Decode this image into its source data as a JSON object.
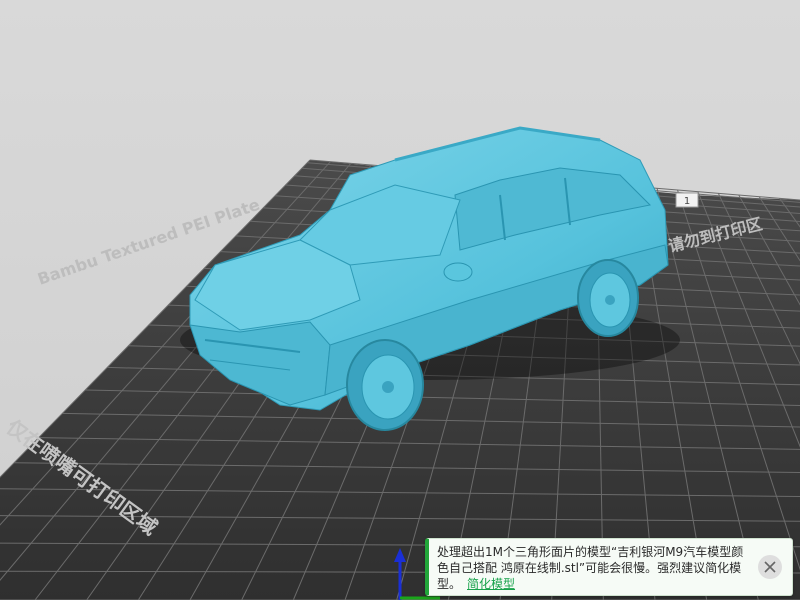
{
  "viewport": {
    "plate_label": "Bambu Textured PEI Plate",
    "printable_label_right": "请勿到打印区",
    "printable_label_left": "仅在喷嘴可打印区域",
    "plate_badge": "1"
  },
  "notification": {
    "message": "处理超出1M个三角形面片的模型“吉利银河M9汽车模型颜色自己搭配 鸿原在线制.stl”可能会很慢。强烈建议简化模型。",
    "link_label": "简化模型",
    "close_icon": "close-icon"
  },
  "colors": {
    "model": "#5ec9e0",
    "plate": "#3c3c3c",
    "grid": "#6e6e6e",
    "background": "#d3d3d3",
    "accent": "#22a63a"
  }
}
